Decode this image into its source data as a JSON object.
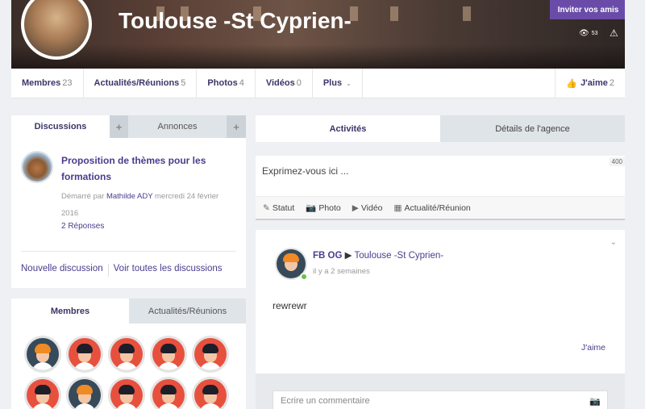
{
  "banner": {
    "title": "Toulouse -St Cyprien-",
    "invite_label": "Inviter vos amis",
    "views_count": "53"
  },
  "nav": {
    "items": [
      {
        "label": "Membres",
        "count": "23"
      },
      {
        "label": "Actualités/Réunions",
        "count": "5"
      },
      {
        "label": "Photos",
        "count": "4"
      },
      {
        "label": "Vidéos",
        "count": "0"
      },
      {
        "label": "Plus",
        "count": ""
      }
    ],
    "like_label": "J'aime",
    "like_count": "2"
  },
  "discussions": {
    "tab_discussions": "Discussions",
    "tab_annonces": "Annonces",
    "plus": "+",
    "item": {
      "title": "Proposition de thèmes pour les formations",
      "started_by": "Démarré par",
      "author": "Mathilde ADY",
      "date": "mercredi 24 février 2016",
      "replies": "2 Réponses"
    },
    "new_discussion": "Nouvelle discussion",
    "see_all": "Voir toutes les discussions"
  },
  "members_panel": {
    "tab_members": "Membres",
    "tab_news": "Actualités/Réunions"
  },
  "activity": {
    "tab_activities": "Activités",
    "tab_details": "Détails de l'agence"
  },
  "composer": {
    "placeholder": "Exprimez-vous ici ...",
    "char_count": "400",
    "actions": [
      "Statut",
      "Photo",
      "Vidéo",
      "Actualité/Réunion"
    ]
  },
  "post": {
    "author": "FB OG",
    "target": "Toulouse -St Cyprien-",
    "time": "il y a 2 semaines",
    "body": "rewrewr",
    "like_label": "J'aime"
  },
  "comment": {
    "placeholder": "Ecrire un commentaire"
  },
  "colors": {
    "accent": "#4a3c8c",
    "invite_button": "#6a4ca8",
    "avatar_red": "#e8503e",
    "avatar_dark": "#364a5a",
    "online": "#6cc04a"
  }
}
